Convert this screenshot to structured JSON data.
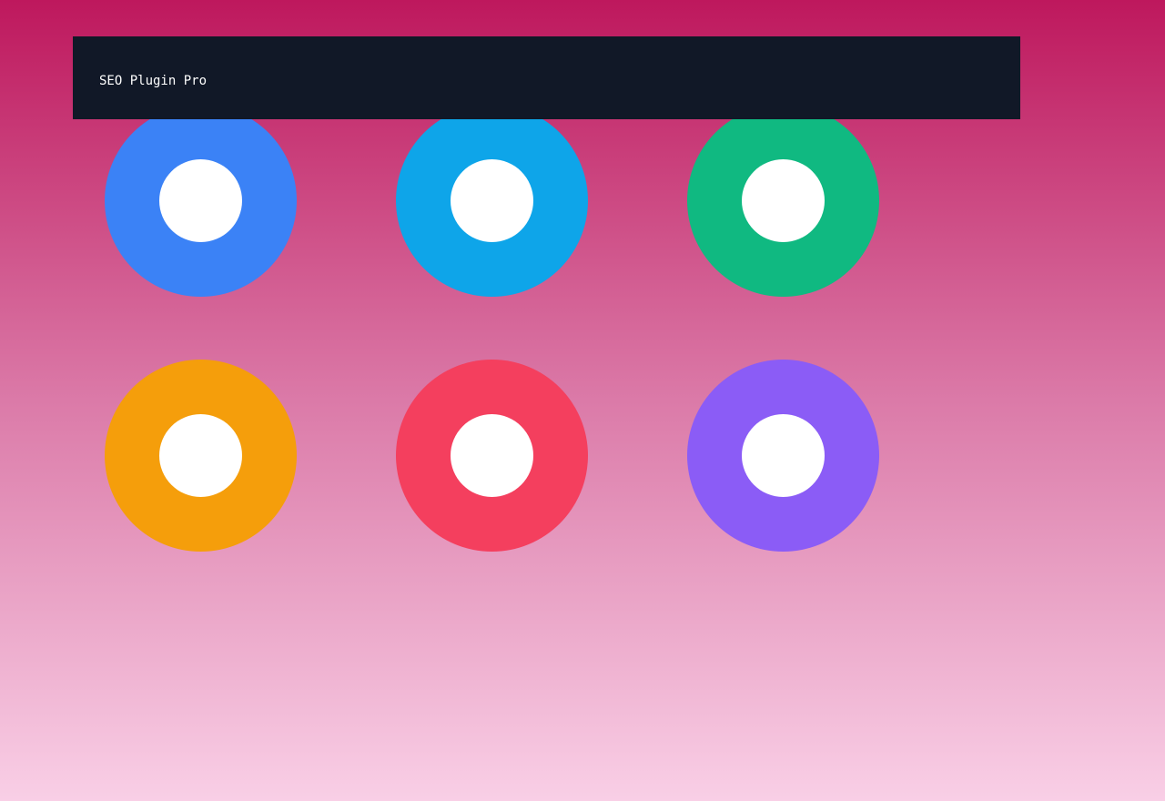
{
  "header": {
    "title": "SEO Plugin Pro",
    "background": "#111827",
    "text_color": "#ffffff"
  },
  "page": {
    "gradient_top": "#be185d",
    "gradient_bottom": "#f9cfe6"
  },
  "rings": [
    {
      "name": "blue-ring",
      "color": "#3b82f6"
    },
    {
      "name": "sky-ring",
      "color": "#0ea5e9"
    },
    {
      "name": "green-ring",
      "color": "#10b981"
    },
    {
      "name": "amber-ring",
      "color": "#f59e0b"
    },
    {
      "name": "red-ring",
      "color": "#f43f5e"
    },
    {
      "name": "violet-ring",
      "color": "#8b5cf6"
    }
  ]
}
